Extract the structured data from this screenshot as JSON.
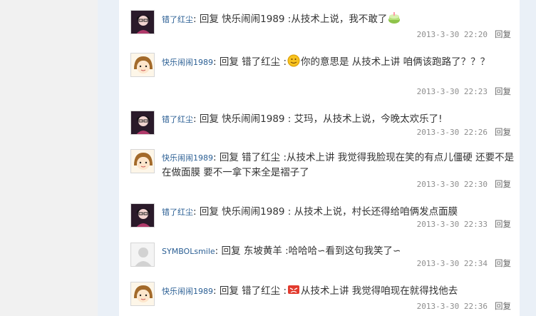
{
  "comments": [
    {
      "avatar_type": "girl-icon",
      "user": "错了红尘",
      "sep": ":",
      "prefix": "回复",
      "target": "快乐闹闹1989",
      "text_before": " :从技术上说，我不敢了",
      "emoticon": "cake-emoticon",
      "text_after": "",
      "time": "2013-3-30 22:20",
      "reply": "回复"
    },
    {
      "avatar_type": "cartoon-girl-icon",
      "user": "快乐闹闹1989",
      "sep": ":",
      "prefix": "回复",
      "target": "错了红尘",
      "text_before": " :",
      "emoticon": "smile-emoticon",
      "text_after": "你的意思是 从技术上讲 咱俩该跑路了？？？",
      "time": "2013-3-30 22:23",
      "reply": "回复"
    },
    {
      "avatar_type": "girl-icon",
      "user": "错了红尘",
      "sep": ":",
      "prefix": "回复",
      "target": "快乐闹闹1989",
      "text_before": " : 艾玛，从技术上说，今晚太欢乐了!",
      "emoticon": "",
      "text_after": "",
      "time": "2013-3-30 22:26",
      "reply": "回复"
    },
    {
      "avatar_type": "cartoon-girl-icon",
      "user": "快乐闹闹1989",
      "sep": ":",
      "prefix": "回复",
      "target": "错了红尘",
      "text_before": " :从技术上讲 我觉得我脸现在笑的有点儿僵硬 还要不是在做面膜 要不一拿下来全是褶子了",
      "emoticon": "",
      "text_after": "",
      "time": "2013-3-30 22:30",
      "reply": "回复"
    },
    {
      "avatar_type": "girl-icon",
      "user": "错了红尘",
      "sep": ":",
      "prefix": "回复",
      "target": "快乐闹闹1989",
      "text_before": " : 从技术上说，村长还得给咱俩发点面膜",
      "emoticon": "",
      "text_after": "",
      "time": "2013-3-30 22:33",
      "reply": "回复"
    },
    {
      "avatar_type": "default-user-icon",
      "user": "SYMBOLsmile",
      "sep": ":",
      "prefix": "回复",
      "target": "东坡黄羊",
      "text_before": " :哈哈哈∽看到这句我笑了∽",
      "emoticon": "",
      "text_after": "",
      "time": "2013-3-30 22:34",
      "reply": "回复"
    },
    {
      "avatar_type": "cartoon-girl-icon",
      "user": "快乐闹闹1989",
      "sep": ":",
      "prefix": "回复",
      "target": "错了红尘",
      "text_before": " :",
      "emoticon": "angry-emoticon",
      "text_after": "从技术上讲 我觉得咱现在就得找他去",
      "time": "2013-3-30 22:36",
      "reply": "回复"
    }
  ]
}
